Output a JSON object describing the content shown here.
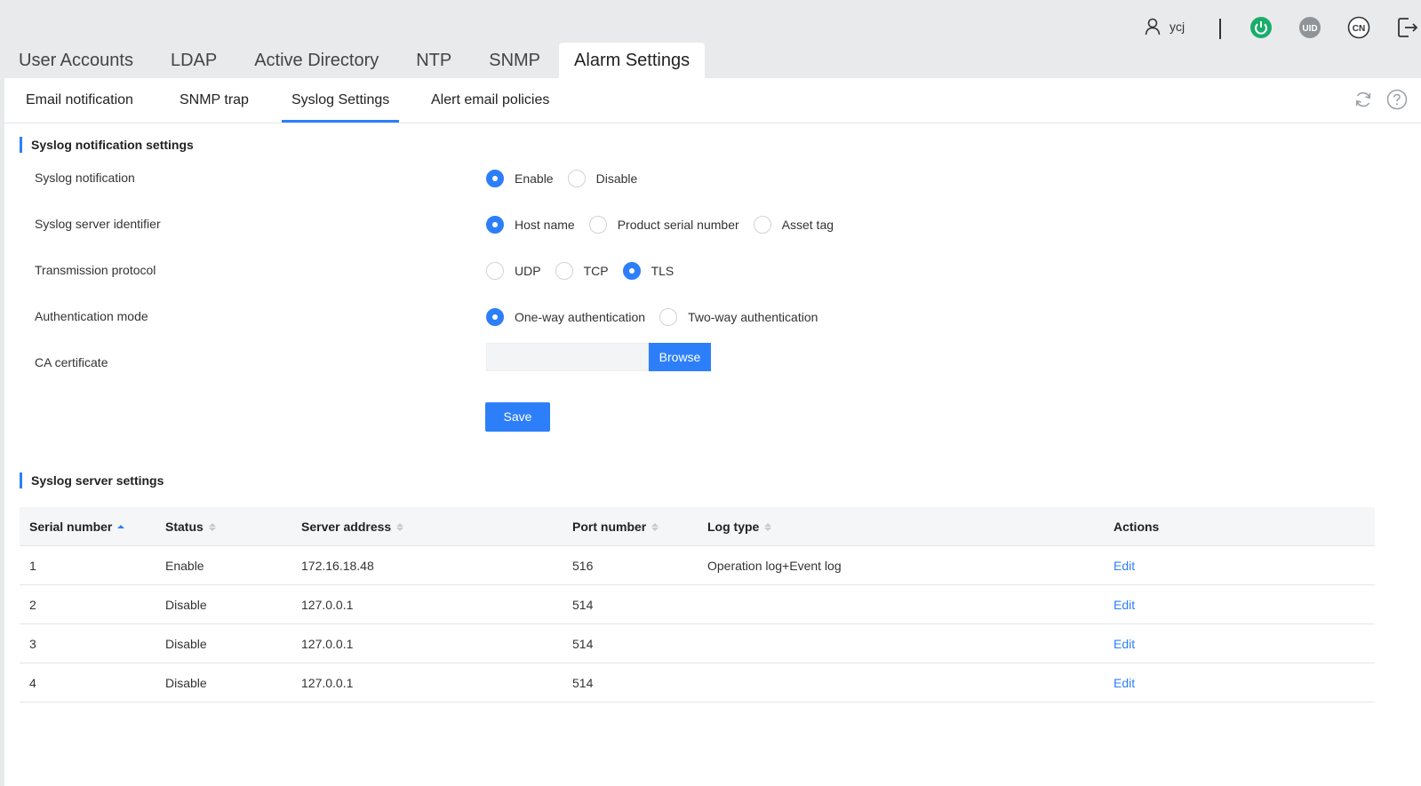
{
  "header": {
    "username": "ycj",
    "icons": [
      "user-icon",
      "power-icon",
      "uid-icon",
      "cn-icon",
      "logout-icon"
    ],
    "power_color": "#1aad6a",
    "badge_color": "#8f9499"
  },
  "main_tabs": [
    {
      "label": "User Accounts",
      "active": false
    },
    {
      "label": "LDAP",
      "active": false
    },
    {
      "label": "Active Directory",
      "active": false
    },
    {
      "label": "NTP",
      "active": false
    },
    {
      "label": "SNMP",
      "active": false
    },
    {
      "label": "Alarm Settings",
      "active": true
    }
  ],
  "sub_tabs": [
    {
      "label": "Email notification",
      "active": false
    },
    {
      "label": "SNMP trap",
      "active": false
    },
    {
      "label": "Syslog Settings",
      "active": true
    },
    {
      "label": "Alert email policies",
      "active": false
    }
  ],
  "notification_section": {
    "title": "Syslog notification settings",
    "rows": [
      {
        "label": "Syslog notification",
        "options": [
          "Enable",
          "Disable"
        ],
        "selected": "Enable"
      },
      {
        "label": "Syslog server identifier",
        "options": [
          "Host name",
          "Product serial number",
          "Asset tag"
        ],
        "selected": "Host name"
      },
      {
        "label": "Transmission protocol",
        "options": [
          "UDP",
          "TCP",
          "TLS"
        ],
        "selected": "TLS"
      },
      {
        "label": "Authentication mode",
        "options": [
          "One-way authentication",
          "Two-way authentication"
        ],
        "selected": "One-way authentication"
      }
    ],
    "ca_certificate_label": "CA certificate",
    "ca_certificate_value": "",
    "browse_label": "Browse",
    "save_label": "Save"
  },
  "server_section": {
    "title": "Syslog server settings",
    "columns": [
      "Serial number",
      "Status",
      "Server address",
      "Port number",
      "Log type",
      "Actions"
    ],
    "rows": [
      {
        "serial": "1",
        "status": "Enable",
        "address": "172.16.18.48",
        "port": "516",
        "log_type": "Operation log+Event log",
        "action": "Edit"
      },
      {
        "serial": "2",
        "status": "Disable",
        "address": "127.0.0.1",
        "port": "514",
        "log_type": "",
        "action": "Edit"
      },
      {
        "serial": "3",
        "status": "Disable",
        "address": "127.0.0.1",
        "port": "514",
        "log_type": "",
        "action": "Edit"
      },
      {
        "serial": "4",
        "status": "Disable",
        "address": "127.0.0.1",
        "port": "514",
        "log_type": "",
        "action": "Edit"
      }
    ]
  },
  "colors": {
    "accent": "#2d7ff9"
  }
}
